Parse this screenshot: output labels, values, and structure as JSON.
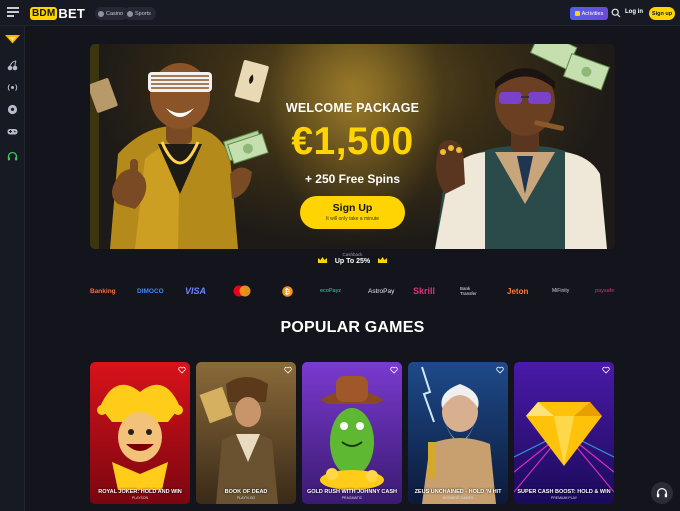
{
  "header": {
    "logo_bdm": "BDM",
    "logo_bet": "BET",
    "tabs": [
      {
        "label": "Casino",
        "icon": "casino-icon"
      },
      {
        "label": "Sports",
        "icon": "sports-icon"
      }
    ],
    "activities_label": "Activities",
    "login_label": "Log in",
    "signup_label": "Sign up"
  },
  "sidebar": {
    "items": [
      {
        "icon": "diamond-badge-icon"
      },
      {
        "icon": "cherries-icon"
      },
      {
        "icon": "live-icon"
      },
      {
        "icon": "soccer-ball-icon"
      },
      {
        "icon": "gamepad-icon"
      },
      {
        "icon": "headset-icon"
      }
    ]
  },
  "hero": {
    "title": "WELCOME PACKAGE",
    "amount": "€1,500",
    "spins": "+ 250 Free Spins",
    "button_label": "Sign Up",
    "button_sub": "It will only take a minute"
  },
  "cashback": {
    "label": "Cashback",
    "value": "Up To 25%"
  },
  "payments": [
    "Banking",
    "DIMOCO",
    "VISA",
    "mastercard",
    "bitcoin",
    "ecoPayz",
    "AstroPay",
    "Skrill",
    "Bank Transfer",
    "Jeton",
    "MiFinity",
    "paysafe"
  ],
  "popular": {
    "title": "POPULAR GAMES",
    "games": [
      {
        "name": "ROYAL JOKER: HOLD AND WIN",
        "provider": "PLAYSON"
      },
      {
        "name": "BOOK OF DEAD",
        "provider": "PLAY'N GO"
      },
      {
        "name": "GOLD RUSH WITH JOHNNY CASH",
        "provider": "PRAGMATIC"
      },
      {
        "name": "ZEUS UNCHAINED - HOLD 'N HIT",
        "provider": "BOOMING GAMES"
      },
      {
        "name": "SUPER CASH BOOST: HOLD & WIN",
        "provider": "PREMIUM PLAY"
      }
    ]
  },
  "colors": {
    "accent": "#ffd400",
    "background": "#14151c",
    "panel": "#181a23",
    "activities": "#5560e8",
    "sidebar_active": "#3ec45a"
  }
}
